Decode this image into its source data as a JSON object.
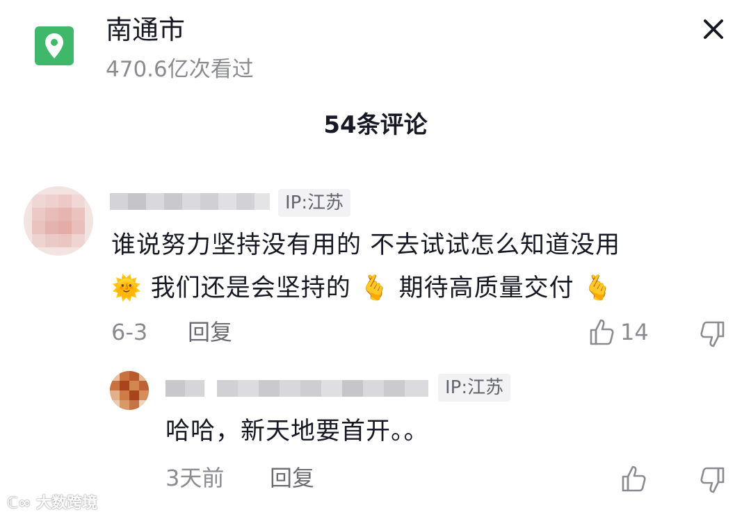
{
  "header": {
    "title": "南通市",
    "views": "470.6亿次看过",
    "icon": "location-pin-icon",
    "accent": "#3fb86a"
  },
  "comments_header": "54条评论",
  "comments": [
    {
      "ip": "IP:江苏",
      "text_line1": "谁说努力坚持没有用的 不去试试怎么知道没用",
      "text_line2_a": "我们还是会坚持的",
      "text_line2_b": "期待高质量交付",
      "emoji_sun": "🌞",
      "emoji_heart_hand": "🫰",
      "date": "6-3",
      "reply_label": "回复",
      "likes": "14"
    }
  ],
  "reply": {
    "ip": "IP:江苏",
    "text": "哈哈，新天地要首开。。",
    "date": "3天前",
    "reply_label": "回复"
  },
  "watermark": "大数跨境"
}
